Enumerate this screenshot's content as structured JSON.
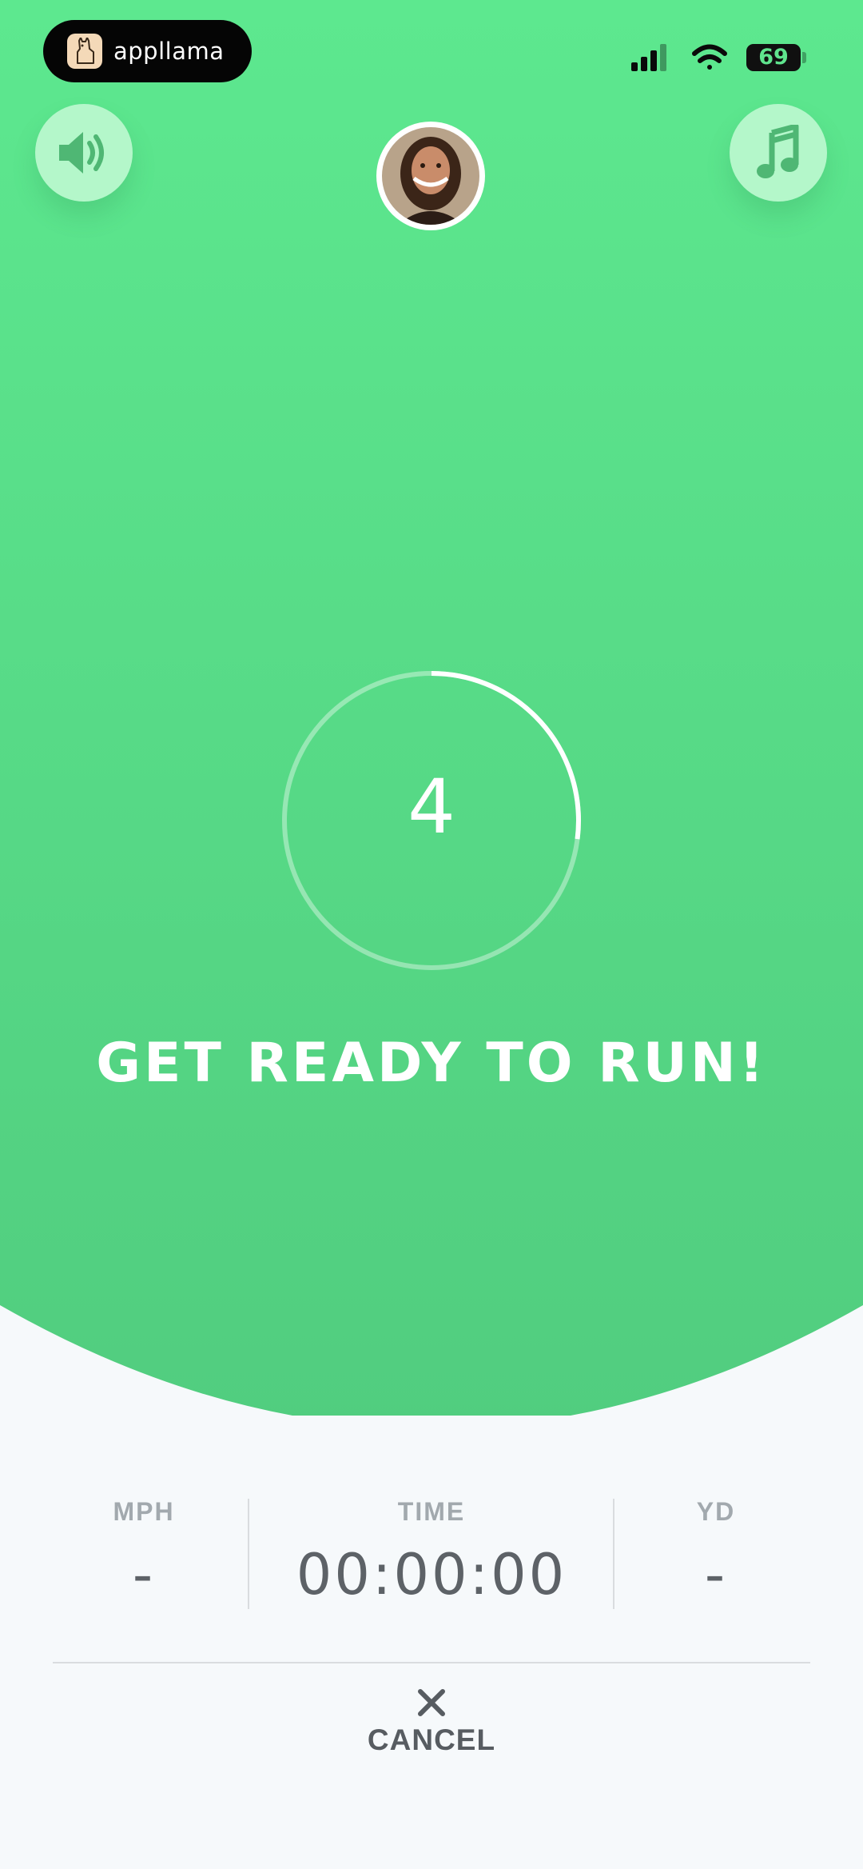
{
  "status_bar": {
    "app_name": "appllama",
    "battery_percent": "69",
    "signal_icon": "cellular-signal-icon",
    "wifi_icon": "wifi-icon"
  },
  "controls": {
    "sound_icon": "speaker-icon",
    "music_icon": "music-note-icon",
    "coach_avatar": "avatar"
  },
  "countdown": {
    "value": "4",
    "progress": 0.27,
    "headline": "GET READY TO RUN!"
  },
  "stats": [
    {
      "label": "MPH",
      "value": "-"
    },
    {
      "label": "TIME",
      "value": "00:00:00"
    },
    {
      "label": "YD",
      "value": "-"
    }
  ],
  "cancel": {
    "label": "CANCEL",
    "icon": "close-icon"
  },
  "colors": {
    "accent_green": "#5be58d",
    "button_green": "#b4f7ca",
    "background": "#f6f9fb",
    "text_gray": "#5d6267"
  }
}
